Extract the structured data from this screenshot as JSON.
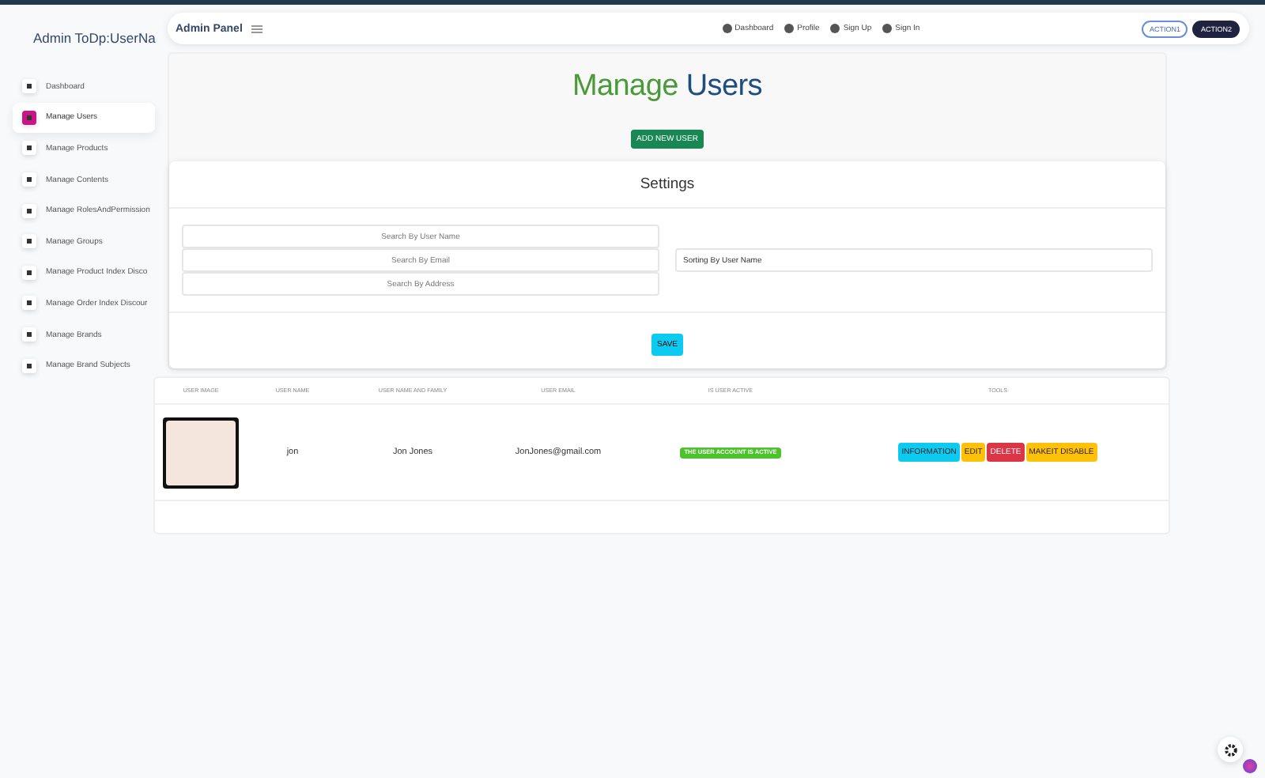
{
  "brand": "Admin ToDp:UserNa",
  "sidebar": {
    "items": [
      {
        "label": "Dashboard",
        "selected": false
      },
      {
        "label": "Manage Users",
        "selected": true
      },
      {
        "label": "Manage Products",
        "selected": false
      },
      {
        "label": "Manage Contents",
        "selected": false
      },
      {
        "label": "Manage RolesAndPermission",
        "selected": false
      },
      {
        "label": "Manage Groups",
        "selected": false
      },
      {
        "label": "Manage Product Index Disco",
        "selected": false
      },
      {
        "label": "Manage Order Index Discour",
        "selected": false
      },
      {
        "label": "Manage Brands",
        "selected": false
      },
      {
        "label": "Manage Brand Subjects",
        "selected": false
      }
    ]
  },
  "navbar": {
    "title": "Admin Panel",
    "links": [
      "Dashboard",
      "Profile",
      "Sign Up",
      "Sign In"
    ],
    "actions": [
      {
        "label": "ACTION1",
        "kind": "outline"
      },
      {
        "label": "ACTION2",
        "kind": "solid"
      }
    ]
  },
  "page_title": {
    "first": "Manage",
    "second": "Users"
  },
  "add_button": "ADD NEW USER",
  "settings": {
    "title": "Settings",
    "search_fields": [
      {
        "placeholder": "Search By User Name"
      },
      {
        "placeholder": "Search By Email"
      },
      {
        "placeholder": "Search By Address"
      }
    ],
    "sorting_value": "Sorting By User Name",
    "save_button": "SAVE"
  },
  "table": {
    "columns": [
      "USER IMAGE",
      "USER NAME",
      "USER NAME AND FAMILY",
      "USER EMAIL",
      "IS USER ACTIVE",
      "TOOLS"
    ],
    "rows": [
      {
        "user_name": "jon",
        "full_name": "Jon Jones",
        "email": "JonJones@gmail.com",
        "status": "THE USER ACCOUNT IS ACTIVE",
        "active": true,
        "tools": [
          {
            "label": "INFORMATION",
            "kind": "info"
          },
          {
            "label": "EDIT",
            "kind": "warning"
          },
          {
            "label": "DELETE",
            "kind": "danger"
          },
          {
            "label": "MAKEIT DISABLE",
            "kind": "warning"
          }
        ]
      }
    ]
  }
}
